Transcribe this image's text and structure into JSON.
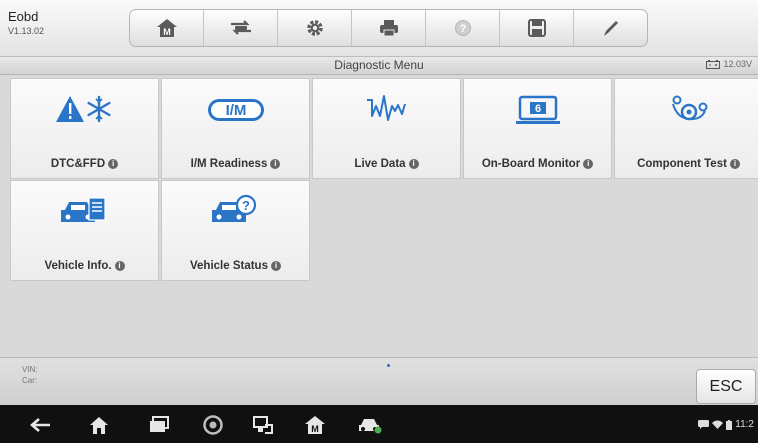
{
  "app": {
    "name": "Eobd",
    "version": "V1.13.02"
  },
  "toolbar": [
    {
      "icon": "home-icon"
    },
    {
      "icon": "vehicle-swap-icon"
    },
    {
      "icon": "settings-icon"
    },
    {
      "icon": "print-icon"
    },
    {
      "icon": "help-icon"
    },
    {
      "icon": "save-icon"
    },
    {
      "icon": "edit-icon"
    }
  ],
  "header": {
    "title": "Diagnostic Menu",
    "battery_voltage": "12.03V"
  },
  "menu": [
    {
      "label": "DTC&FFD",
      "icon": "dtc-ffd-icon",
      "info": "i"
    },
    {
      "label": "I/M Readiness",
      "icon": "im-readiness-icon",
      "icon_text": "I/M",
      "info": "i"
    },
    {
      "label": "Live Data",
      "icon": "live-data-icon",
      "info": "i"
    },
    {
      "label": "On-Board Monitor",
      "icon": "onboard-monitor-icon",
      "icon_text": "6",
      "info": "i"
    },
    {
      "label": "Component Test",
      "icon": "component-test-icon",
      "info": "i"
    },
    {
      "label": "Vehicle Info.",
      "icon": "vehicle-info-icon",
      "info": "i"
    },
    {
      "label": "Vehicle Status",
      "icon": "vehicle-status-icon",
      "icon_text": "?",
      "info": "i"
    }
  ],
  "footer": {
    "vin_label": "VIN:",
    "car_label": "Car:",
    "esc_label": "ESC"
  },
  "navbar": {
    "items": [
      "back-icon",
      "home-icon",
      "recent-apps-icon",
      "chrome-icon",
      "remote-desktop-icon",
      "maxisys-home-icon",
      "vehicle-icon"
    ],
    "status_time": "11:2"
  }
}
